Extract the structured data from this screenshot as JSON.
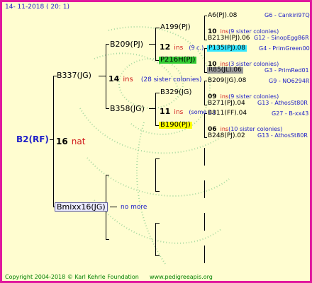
{
  "header": {
    "date": "14- 11-2018 ( 20: 1)"
  },
  "footer": {
    "copyright": "Copyright 2004-2018 © Karl Kehrle Foundation",
    "url": "www.pedigreeapis.org"
  },
  "root": {
    "id": "B2(RF)",
    "generation": "16",
    "race": "nat"
  },
  "gen1": {
    "father": {
      "id": "B337(JG)",
      "generation": "14",
      "ins": "ins",
      "note": "(28 sister colonies)"
    },
    "mother": {
      "id": "Bmixx16(JG)",
      "note": "no more"
    }
  },
  "gen2": {
    "ff": {
      "id": "B209(PJ)",
      "generation": "12",
      "ins": "ins",
      "note": "(9 c.)"
    },
    "fm": {
      "id": "B358(JG)",
      "generation": "11",
      "ins": "ins",
      "note": "(some c.)"
    }
  },
  "gen3": {
    "fff": {
      "id": "A199(PJ)"
    },
    "ffm": {
      "id": "P216H(PJ)"
    },
    "fmf": {
      "id": "B329(JG)"
    },
    "fmm": {
      "id": "B190(PJ)"
    }
  },
  "gen4": [
    {
      "id": "A6(PJ).08",
      "gen": "G6",
      "name": "Cankiri97Q"
    },
    {
      "generation": "10",
      "ins": "ins",
      "note": "(9 sister colonies)"
    },
    {
      "id": "B213H(PJ).06",
      "gen": "G12",
      "name": "SinopEgg86R"
    },
    {
      "id": "P135(PJ).08",
      "gen": "G4",
      "name": "PrimGreen00"
    },
    {
      "generation": "10",
      "ins": "ins",
      "note": "(3 sister colonies)"
    },
    {
      "id": "R85(JL).06",
      "gen": "G3",
      "name": "PrimRed01"
    },
    {
      "id": "B209(JG).08",
      "gen": "G9",
      "name": "NO6294R"
    },
    {
      "generation": "09",
      "ins": "ins",
      "note": "(9 sister colonies)"
    },
    {
      "id": "B271(PJ).04",
      "gen": "G13",
      "name": "AthosSt80R"
    },
    {
      "id": "B811(FF).04",
      "gen": "G27",
      "name": "B-xx43"
    },
    {
      "generation": "06",
      "ins": "ins",
      "note": "(10 sister colonies)"
    },
    {
      "id": "B248(PJ).02",
      "gen": "G13",
      "name": "AthosSt80R"
    }
  ],
  "colors": {
    "frame": "#e0189e",
    "background": "#fffdd0",
    "green_highlight": "#33cc33",
    "cyan_highlight": "#33e6ff",
    "yellow_highlight": "#ffff00",
    "gray_highlight": "#9a9a9a"
  }
}
